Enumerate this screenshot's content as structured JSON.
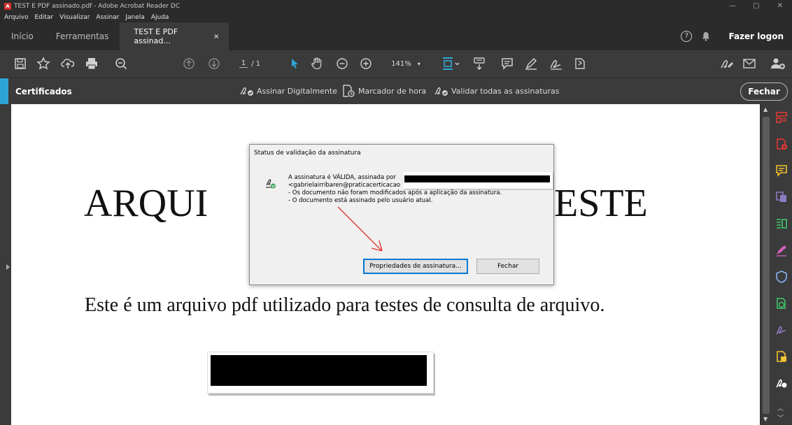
{
  "window": {
    "title": "TEST E PDF assinado.pdf - Adobe Acrobat Reader DC",
    "controls": [
      "—",
      "▢",
      "✕"
    ]
  },
  "menu": [
    "Arquivo",
    "Editar",
    "Visualizar",
    "Assinar",
    "Janela",
    "Ajuda"
  ],
  "tabs": {
    "home": "Início",
    "tools": "Ferramentas",
    "document": "TEST E PDF assinad...",
    "close": "×",
    "help": "?",
    "login": "Fazer logon"
  },
  "toolbar": {
    "page_current": "1",
    "page_total": "/ 1",
    "zoom": "141%"
  },
  "cert_bar": {
    "title": "Certificados",
    "sign_digitally": "Assinar Digitalmente",
    "timestamp": "Marcador de hora",
    "validate_all": "Validar todas as assinaturas",
    "close": "Fechar"
  },
  "document": {
    "heading_left": "ARQUI",
    "heading_right": "ESTE",
    "body": "Este é um arquivo pdf utilizado para testes de consulta de arquivo."
  },
  "dialog": {
    "title": "Status de validação da assinatura",
    "message": "A assinatura é VÁLIDA, assinada por \n<gabrielairribaren@praticacerticacao\n- Os documento não foram modificados após a aplicação da assinatura.\n- O documento está assinado pelo usuário atual.",
    "properties_button": "Propriedades de assinatura...",
    "close_button": "Fechar"
  },
  "colors": {
    "accent": "#2fa5d6",
    "annotation_arrow": "#e53935",
    "right_panel_icons": [
      "#e53935",
      "#e53935",
      "#f2c230",
      "#8e7cc3",
      "#3ec66b",
      "#d35fb7",
      "#8ab4f8",
      "#3ec66b",
      "#8e7cc3",
      "#f2c230",
      "#ffffff"
    ]
  }
}
